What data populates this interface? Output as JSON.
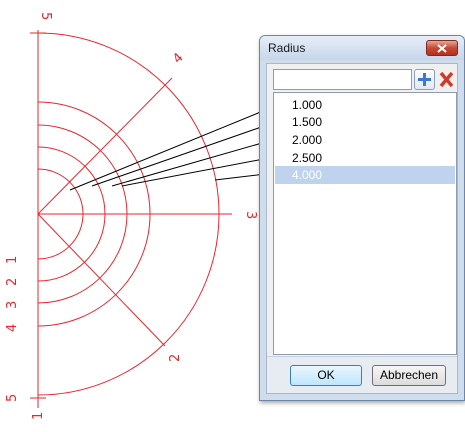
{
  "drawing": {
    "axis_labels": [
      "5",
      "4",
      "3",
      "2",
      "1",
      "2",
      "3",
      "4",
      "5",
      "1"
    ],
    "line_color": "#e8262e",
    "leader_color": "#000000"
  },
  "dialog": {
    "title": "Radius",
    "entry_value": "",
    "items": [
      "1.000",
      "1.500",
      "2.000",
      "2.500",
      "4.000"
    ],
    "selected_index": 4,
    "ok_label": "OK",
    "cancel_label": "Abbrechen"
  },
  "icons": {
    "close": "close-icon",
    "add": "plus-icon",
    "delete": "delete-icon"
  }
}
